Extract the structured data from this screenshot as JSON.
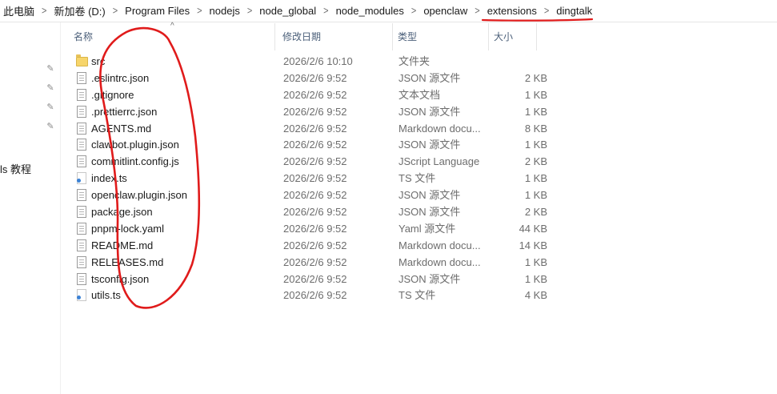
{
  "breadcrumb": [
    "此电脑",
    "新加卷 (D:)",
    "Program Files",
    "nodejs",
    "node_global",
    "node_modules",
    "openclaw",
    "extensions",
    "dingtalk"
  ],
  "nav": {
    "partial_label": "ls 教程"
  },
  "columns": {
    "name": "名称",
    "date": "修改日期",
    "type": "类型",
    "size": "大小"
  },
  "files": [
    {
      "icon": "folder",
      "name": "src",
      "date": "2026/2/6 10:10",
      "type": "文件夹",
      "size": ""
    },
    {
      "icon": "doc",
      "name": ".eslintrc.json",
      "date": "2026/2/6 9:52",
      "type": "JSON 源文件",
      "size": "2 KB"
    },
    {
      "icon": "doc",
      "name": ".gitignore",
      "date": "2026/2/6 9:52",
      "type": "文本文档",
      "size": "1 KB"
    },
    {
      "icon": "doc",
      "name": ".prettierrc.json",
      "date": "2026/2/6 9:52",
      "type": "JSON 源文件",
      "size": "1 KB"
    },
    {
      "icon": "doc",
      "name": "AGENTS.md",
      "date": "2026/2/6 9:52",
      "type": "Markdown docu...",
      "size": "8 KB"
    },
    {
      "icon": "doc",
      "name": "clawbot.plugin.json",
      "date": "2026/2/6 9:52",
      "type": "JSON 源文件",
      "size": "1 KB"
    },
    {
      "icon": "doc",
      "name": "commitlint.config.js",
      "date": "2026/2/6 9:52",
      "type": "JScript Language",
      "size": "2 KB"
    },
    {
      "icon": "ts",
      "name": "index.ts",
      "date": "2026/2/6 9:52",
      "type": "TS 文件",
      "size": "1 KB"
    },
    {
      "icon": "doc",
      "name": "openclaw.plugin.json",
      "date": "2026/2/6 9:52",
      "type": "JSON 源文件",
      "size": "1 KB"
    },
    {
      "icon": "doc",
      "name": "package.json",
      "date": "2026/2/6 9:52",
      "type": "JSON 源文件",
      "size": "2 KB"
    },
    {
      "icon": "doc",
      "name": "pnpm-lock.yaml",
      "date": "2026/2/6 9:52",
      "type": "Yaml 源文件",
      "size": "44 KB"
    },
    {
      "icon": "doc",
      "name": "README.md",
      "date": "2026/2/6 9:52",
      "type": "Markdown docu...",
      "size": "14 KB"
    },
    {
      "icon": "doc",
      "name": "RELEASES.md",
      "date": "2026/2/6 9:52",
      "type": "Markdown docu...",
      "size": "1 KB"
    },
    {
      "icon": "doc",
      "name": "tsconfig.json",
      "date": "2026/2/6 9:52",
      "type": "JSON 源文件",
      "size": "1 KB"
    },
    {
      "icon": "ts",
      "name": "utils.ts",
      "date": "2026/2/6 9:52",
      "type": "TS 文件",
      "size": "4 KB"
    }
  ],
  "colors": {
    "annotation": "#e01b1b",
    "header_text": "#4c607a",
    "hover": "#e5f3ff"
  }
}
